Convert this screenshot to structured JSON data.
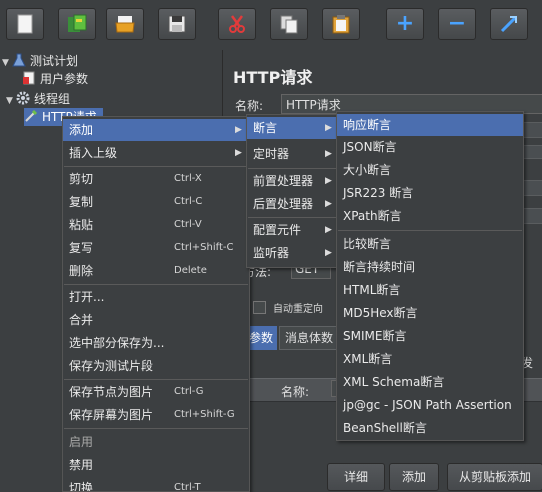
{
  "toolbar": {
    "buttons": [
      {
        "icon": "new-document-icon"
      },
      {
        "icon": "templates-icon"
      },
      {
        "icon": "open-icon"
      },
      {
        "icon": "save-icon"
      },
      {
        "icon": "cut-icon"
      },
      {
        "icon": "copy-icon"
      },
      {
        "icon": "paste-icon"
      },
      {
        "icon": "expand-all-icon",
        "glyph": "+"
      },
      {
        "icon": "collapse-all-icon",
        "glyph": "−"
      },
      {
        "icon": "toggle-icon"
      }
    ]
  },
  "tree": {
    "test_plan": "测试计划",
    "user_params": "用户参数",
    "thread_group": "线程组",
    "http_request": "HTTP请求"
  },
  "panel": {
    "title": "HTTP请求",
    "name_label": "名称:",
    "name_value": "HTTP请求",
    "method_label": "方法:",
    "method_value": "GET",
    "redirect_label": "自动重定向",
    "tab_params": "参数",
    "tab_body": "消息体数",
    "col_name": "名称:",
    "right_edge_text": "发",
    "btn_detail": "详细",
    "btn_add": "添加",
    "btn_paste": "从剪贴板添加"
  },
  "context_menu": {
    "items": [
      {
        "label": "添加",
        "submenu": true,
        "highlighted": true
      },
      {
        "label": "插入上级",
        "submenu": true
      },
      {
        "label": "剪切",
        "shortcut": "Ctrl-X"
      },
      {
        "label": "复制",
        "shortcut": "Ctrl-C"
      },
      {
        "label": "粘贴",
        "shortcut": "Ctrl-V"
      },
      {
        "label": "复写",
        "shortcut": "Ctrl+Shift-C"
      },
      {
        "label": "删除",
        "shortcut": "Delete"
      },
      {
        "label": "打开..."
      },
      {
        "label": "合并"
      },
      {
        "label": "选中部分保存为..."
      },
      {
        "label": "保存为测试片段"
      },
      {
        "label": "保存节点为图片",
        "shortcut": "Ctrl-G"
      },
      {
        "label": "保存屏幕为图片",
        "shortcut": "Ctrl+Shift-G"
      },
      {
        "label": "启用",
        "disabled": true
      },
      {
        "label": "禁用"
      },
      {
        "label": "切换",
        "shortcut": "Ctrl-T"
      }
    ]
  },
  "add_submenu": {
    "items": [
      {
        "label": "断言",
        "submenu": true,
        "highlighted": true
      },
      {
        "label": "定时器",
        "submenu": true
      },
      {
        "label": "前置处理器",
        "submenu": true
      },
      {
        "label": "后置处理器",
        "submenu": true
      },
      {
        "label": "配置元件",
        "submenu": true
      },
      {
        "label": "监听器",
        "submenu": true
      }
    ]
  },
  "assertion_submenu": {
    "items": [
      {
        "label": "响应断言",
        "highlighted": true
      },
      {
        "label": "JSON断言"
      },
      {
        "label": "大小断言"
      },
      {
        "label": "JSR223 断言"
      },
      {
        "label": "XPath断言"
      },
      {
        "label": "比较断言"
      },
      {
        "label": "断言持续时间"
      },
      {
        "label": "HTML断言"
      },
      {
        "label": "MD5Hex断言"
      },
      {
        "label": "SMIME断言"
      },
      {
        "label": "XML断言"
      },
      {
        "label": "XML Schema断言"
      },
      {
        "label": "jp@gc - JSON Path Assertion"
      },
      {
        "label": "BeanShell断言"
      }
    ]
  },
  "colors": {
    "background": "#3c3f41",
    "highlight": "#4b6eaf",
    "text": "#eaeaea"
  }
}
